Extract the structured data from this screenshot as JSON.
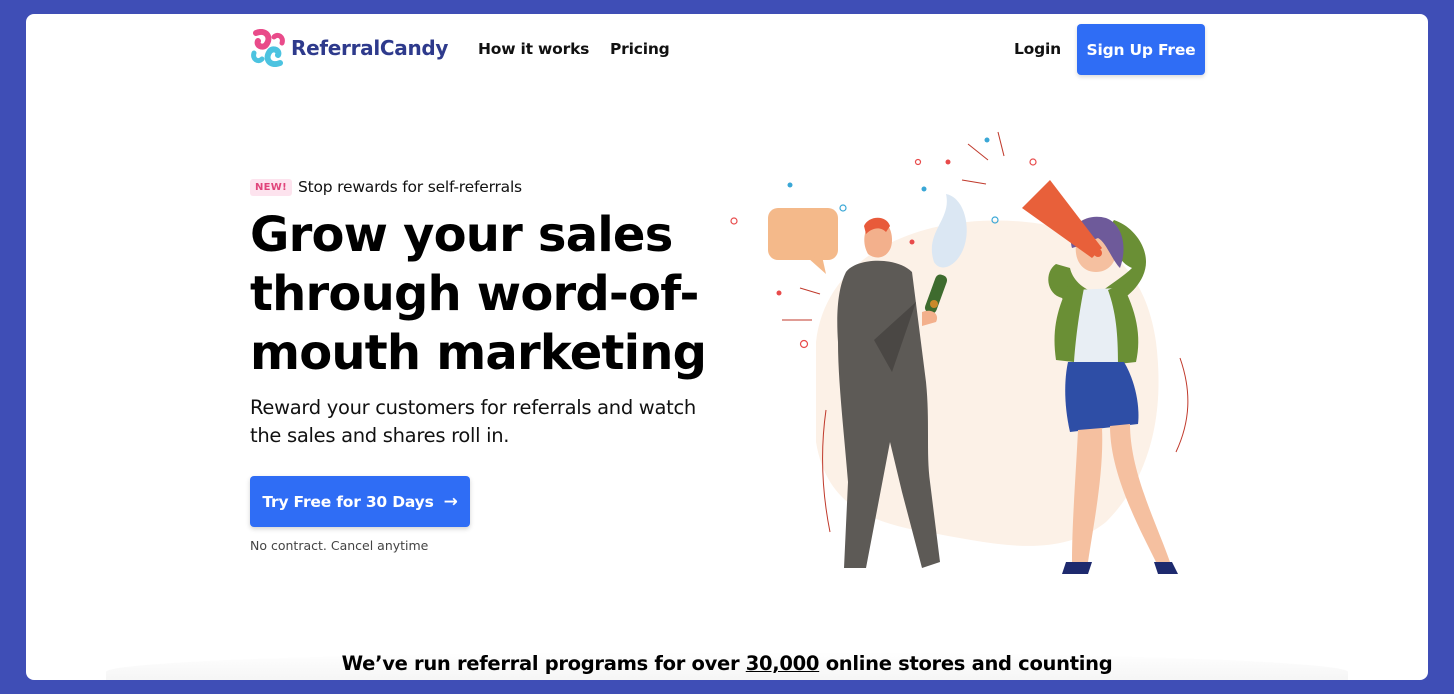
{
  "nav": {
    "brand": "ReferralCandy",
    "links": [
      "How it works",
      "Pricing"
    ],
    "login": "Login",
    "signup": "Sign Up Free"
  },
  "hero": {
    "badge": "NEW!",
    "announcement": "Stop rewards for self-referrals",
    "headline": "Grow your sales through word-of-mouth marketing",
    "subhead": "Reward your customers for referrals and watch the sales and shares roll in.",
    "cta": "Try Free for 30 Days",
    "cta_icon": "arrow-right-icon",
    "note": "No contract. Cancel anytime"
  },
  "stats": {
    "prefix": "We’ve run referral programs for over ",
    "number": "30,000",
    "suffix": " online stores and counting"
  },
  "colors": {
    "background": "#3f4eb6",
    "accent": "#2f6df5",
    "badge_bg": "#fde3ee",
    "badge_text": "#e0457b",
    "brand_text": "#2e3a8c"
  }
}
